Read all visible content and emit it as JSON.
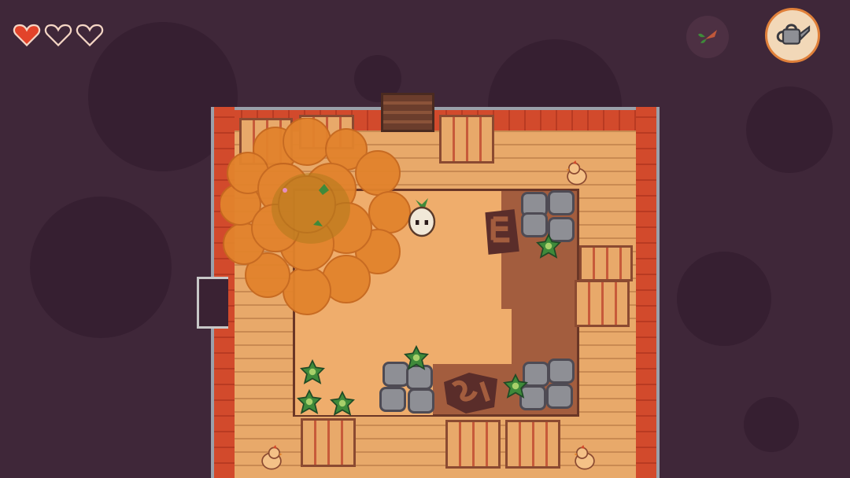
{
  "hud": {
    "hearts": [
      {
        "state": "full",
        "icon": "heart-full-icon"
      },
      {
        "state": "empty",
        "icon": "heart-empty-icon"
      },
      {
        "state": "empty",
        "icon": "heart-empty-icon"
      }
    ],
    "inventory_item_icon": "carrot-sprout-icon",
    "equipped_tool_icon": "watering-can-icon"
  },
  "colors": {
    "background": "#3f2739",
    "heart_full": "#e2432a",
    "brick": "#d24a2c",
    "floor": "#e8a96a",
    "dirt": "#a35d3e",
    "foliage": "#e2832c",
    "rock": "#8e8f95",
    "leaf": "#3f8a3a"
  }
}
